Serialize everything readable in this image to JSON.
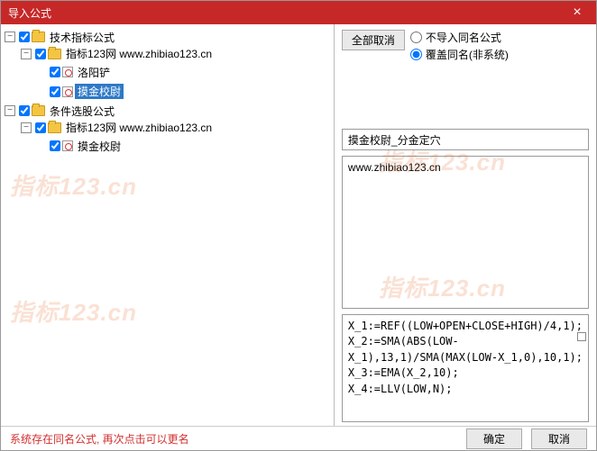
{
  "window": {
    "title": "导入公式",
    "close": "×"
  },
  "toolbar": {
    "deselect_all": "全部取消"
  },
  "radios": {
    "skip_same": "不导入同名公式",
    "overwrite": "覆盖同名(非系统)",
    "selected": "overwrite"
  },
  "tree": {
    "n0": "技术指标公式",
    "n0_0": "指标123网 www.zhibiao123.cn",
    "n0_0_0": "洛阳铲",
    "n0_0_1": "摸金校尉",
    "n1": "条件选股公式",
    "n1_0": "指标123网 www.zhibiao123.cn",
    "n1_0_0": "摸金校尉"
  },
  "detail": {
    "name": "摸金校尉_分金定穴",
    "desc": "www.zhibiao123.cn",
    "code": "X_1:=REF((LOW+OPEN+CLOSE+HIGH)/4,1);\nX_2:=SMA(ABS(LOW-X_1),13,1)/SMA(MAX(LOW-X_1,0),10,1);\nX_3:=EMA(X_2,10);\nX_4:=LLV(LOW,N);"
  },
  "footer": {
    "status": "系统存在同名公式, 再次点击可以更名",
    "ok": "确定",
    "cancel": "取消"
  },
  "watermark": "指标123.cn"
}
